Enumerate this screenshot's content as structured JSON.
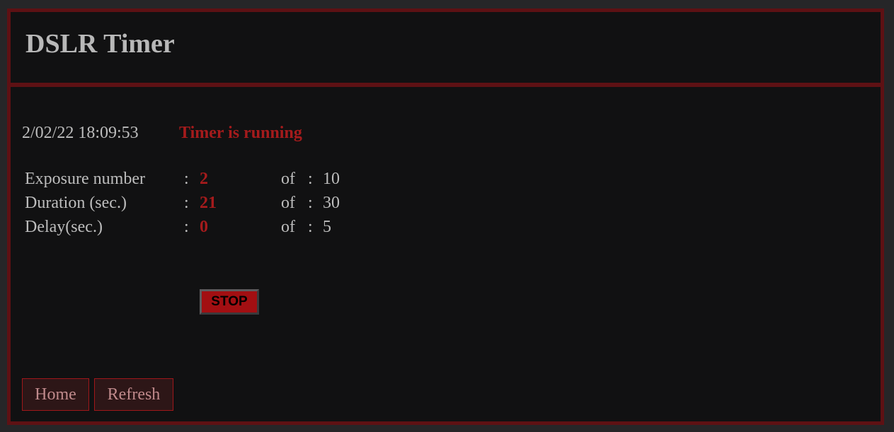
{
  "header": {
    "title": "DSLR Timer"
  },
  "status": {
    "datetime": "2/02/22 18:09:53",
    "timer_status": "Timer is running"
  },
  "stats": [
    {
      "label": "Exposure number",
      "value": "2",
      "of_label": "of",
      "total": "10"
    },
    {
      "label": "Duration (sec.)",
      "value": "21",
      "of_label": "of",
      "total": "30"
    },
    {
      "label": "Delay(sec.)",
      "value": "0",
      "of_label": "of",
      "total": "5"
    }
  ],
  "separator": ":",
  "controls": {
    "stop_label": "STOP"
  },
  "nav": {
    "home_label": "Home",
    "refresh_label": "Refresh"
  },
  "colors": {
    "accent": "#a51b1c",
    "border": "#5e1114",
    "background": "#111112",
    "text": "#bdbdbd"
  }
}
